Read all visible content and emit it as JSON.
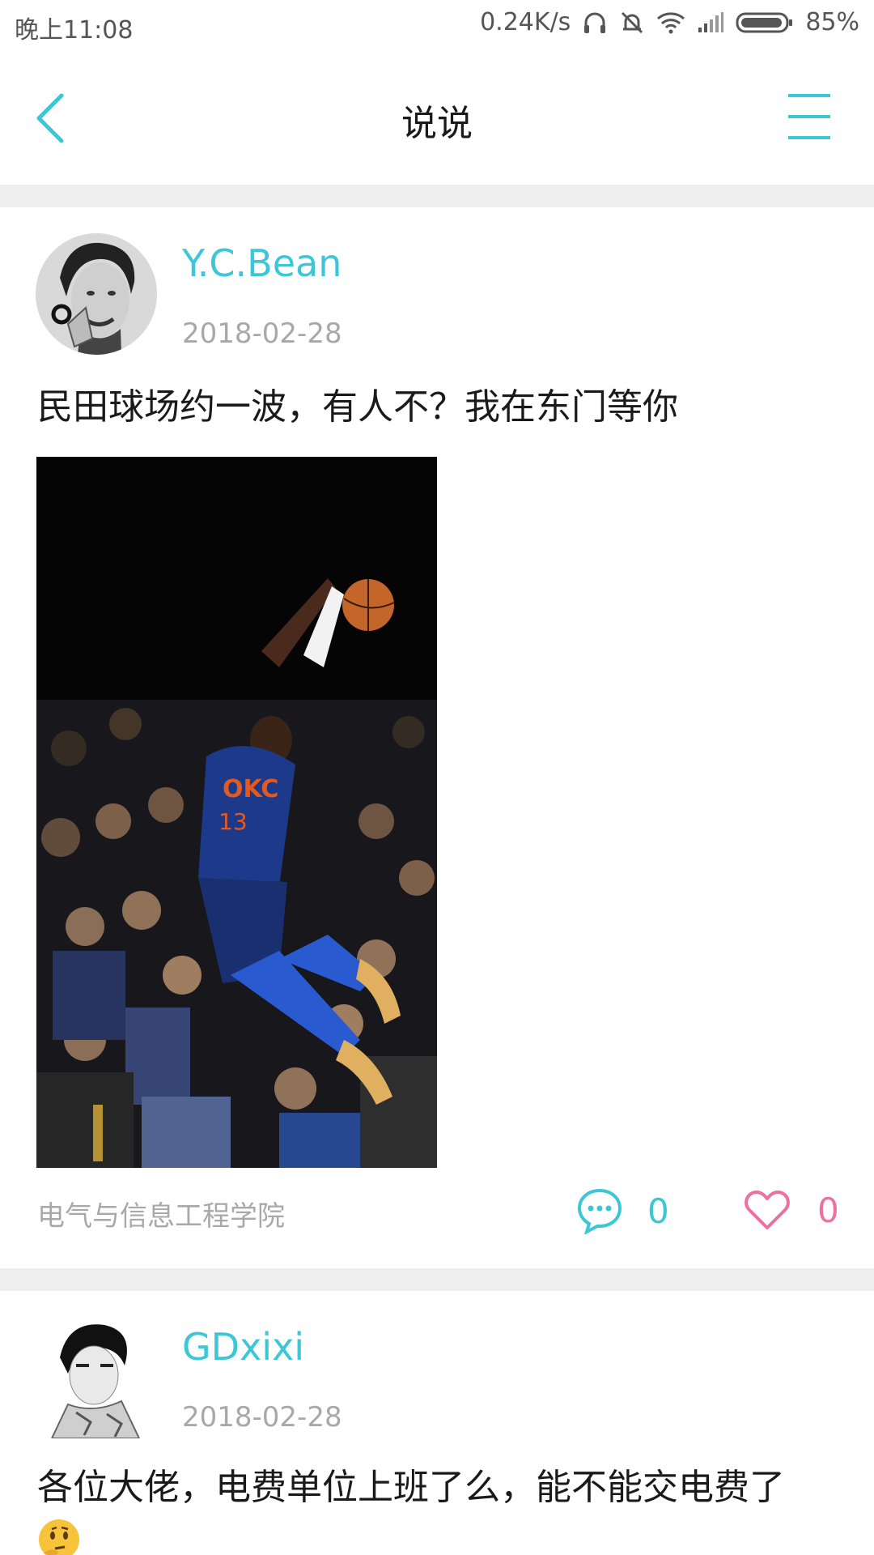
{
  "status_bar": {
    "time": "晚上11:08",
    "network_speed": "0.24K/s",
    "battery": "85%"
  },
  "header": {
    "title": "说说",
    "back_icon": "chevron-left-icon",
    "menu_icon": "menu-icon"
  },
  "colors": {
    "accent": "#3cc6d6",
    "like": "#ef6f9e",
    "muted": "#a8a8a8",
    "divider": "#eeeeee"
  },
  "posts": [
    {
      "username": "Y.C.Bean",
      "date": "2018-02-28",
      "text": "民田球场约一波，有人不？我在东门等你",
      "group": "电气与信息工程学院",
      "comments": "0",
      "likes": "0"
    },
    {
      "username": "GDxixi",
      "date": "2018-02-28",
      "text": "各位大佬，电费单位上班了么，能不能交电费了"
    }
  ]
}
